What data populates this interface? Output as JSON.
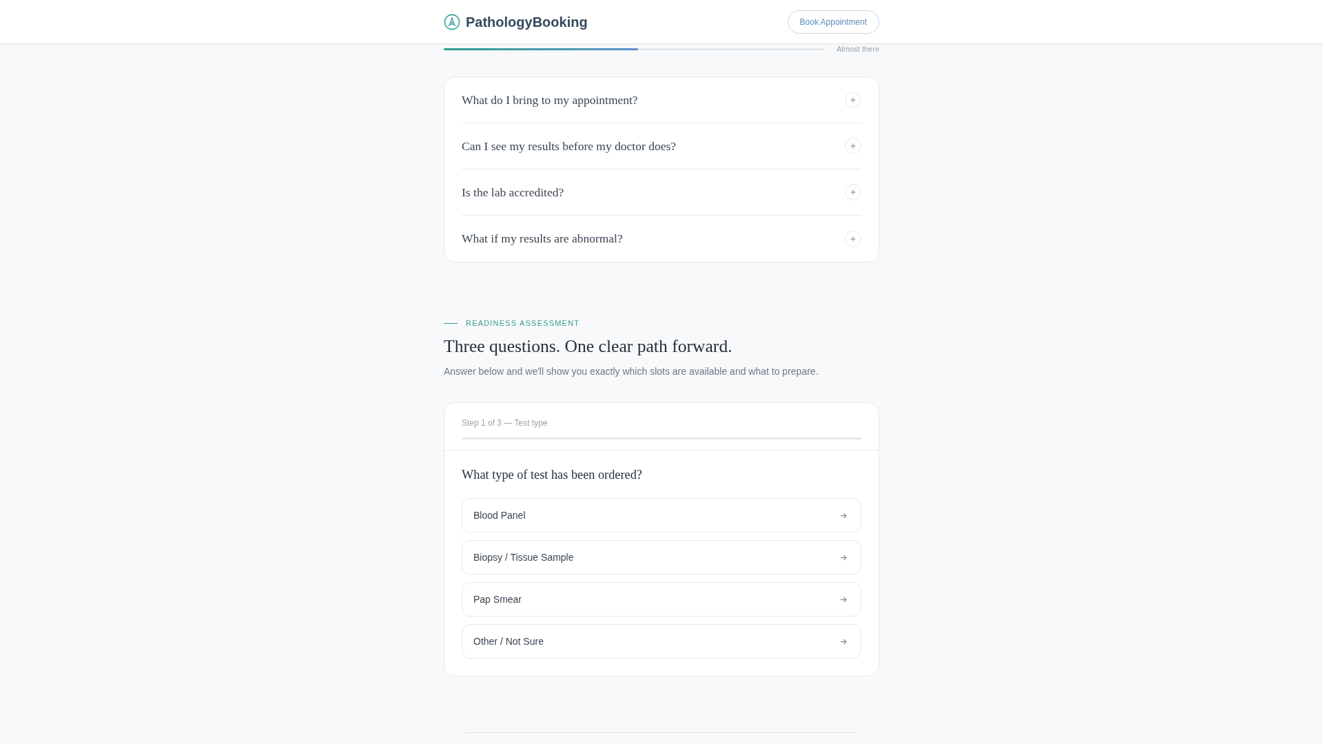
{
  "header": {
    "brand": "PathologyBooking",
    "button": "Book Appointment"
  },
  "progress": {
    "level": 0.51,
    "label": "Almost there"
  },
  "faq": [
    {
      "question": "What do I bring to my appointment?",
      "expanded": false
    },
    {
      "question": "Can I see my results before my doctor does?",
      "expanded": false
    },
    {
      "question": "Is the lab accredited?",
      "expanded": false
    },
    {
      "question": "What if my results are abnormal?",
      "expanded": false
    }
  ],
  "assessment": {
    "eyebrow": "READINESS ASSESSMENT",
    "title": "Three questions. One clear path forward.",
    "subtitle": "Answer below and we'll show you exactly which slots are available and what to prepare.",
    "step": {
      "label": "Step 1 of 3 — Test type"
    },
    "question": "What type of test has been ordered?",
    "options": [
      {
        "label": "Blood Panel",
        "selected": false
      },
      {
        "label": "Biopsy / Tissue Sample",
        "selected": false
      },
      {
        "label": "Pap Smear",
        "selected": false
      },
      {
        "label": "Other / Not Sure",
        "selected": false
      }
    ]
  }
}
